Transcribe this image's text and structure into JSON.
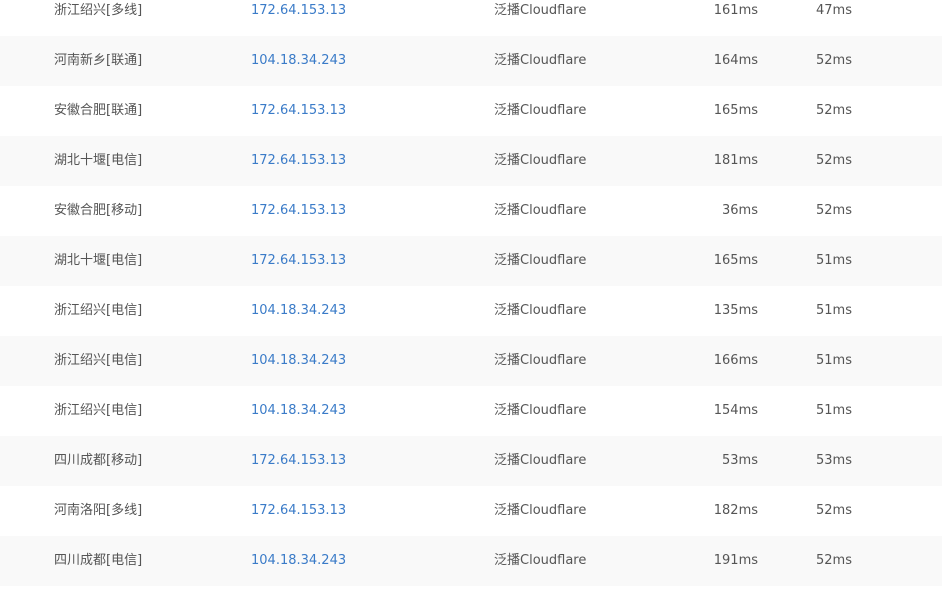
{
  "rows": [
    {
      "location": "浙江绍兴[多线]",
      "ip": "172.64.153.13",
      "isp": "泛播Cloudflare",
      "time1": "161ms",
      "time2": "47ms"
    },
    {
      "location": "河南新乡[联通]",
      "ip": "104.18.34.243",
      "isp": "泛播Cloudflare",
      "time1": "164ms",
      "time2": "52ms"
    },
    {
      "location": "安徽合肥[联通]",
      "ip": "172.64.153.13",
      "isp": "泛播Cloudflare",
      "time1": "165ms",
      "time2": "52ms"
    },
    {
      "location": "湖北十堰[电信]",
      "ip": "172.64.153.13",
      "isp": "泛播Cloudflare",
      "time1": "181ms",
      "time2": "52ms"
    },
    {
      "location": "安徽合肥[移动]",
      "ip": "172.64.153.13",
      "isp": "泛播Cloudflare",
      "time1": "36ms",
      "time2": "52ms"
    },
    {
      "location": "湖北十堰[电信]",
      "ip": "172.64.153.13",
      "isp": "泛播Cloudflare",
      "time1": "165ms",
      "time2": "51ms"
    },
    {
      "location": "浙江绍兴[电信]",
      "ip": "104.18.34.243",
      "isp": "泛播Cloudflare",
      "time1": "135ms",
      "time2": "51ms"
    },
    {
      "location": "浙江绍兴[电信]",
      "ip": "104.18.34.243",
      "isp": "泛播Cloudflare",
      "time1": "166ms",
      "time2": "51ms"
    },
    {
      "location": "浙江绍兴[电信]",
      "ip": "104.18.34.243",
      "isp": "泛播Cloudflare",
      "time1": "154ms",
      "time2": "51ms"
    },
    {
      "location": "四川成都[移动]",
      "ip": "172.64.153.13",
      "isp": "泛播Cloudflare",
      "time1": "53ms",
      "time2": "53ms"
    },
    {
      "location": "河南洛阳[多线]",
      "ip": "172.64.153.13",
      "isp": "泛播Cloudflare",
      "time1": "182ms",
      "time2": "52ms"
    },
    {
      "location": "四川成都[电信]",
      "ip": "104.18.34.243",
      "isp": "泛播Cloudflare",
      "time1": "191ms",
      "time2": "52ms"
    }
  ],
  "colors": {
    "link": "#3a7bc8",
    "text": "#555555",
    "row_alt": "#f9f9f9"
  }
}
